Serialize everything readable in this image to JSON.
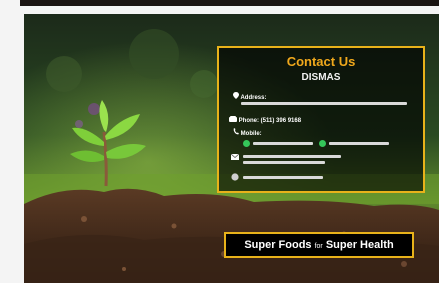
{
  "contact": {
    "title": "Contact Us",
    "company": "DISMAS",
    "address_label": "Address:",
    "phone_label": "Phone: (511) 396 9168",
    "mobile_label": "Mobile:"
  },
  "slogan": {
    "part1": "Super Foods ",
    "part2": "for",
    "part3": " Super Health"
  },
  "colors": {
    "accent": "#e8b21a",
    "title": "#f0a81c",
    "whatsapp": "#35c75a"
  }
}
